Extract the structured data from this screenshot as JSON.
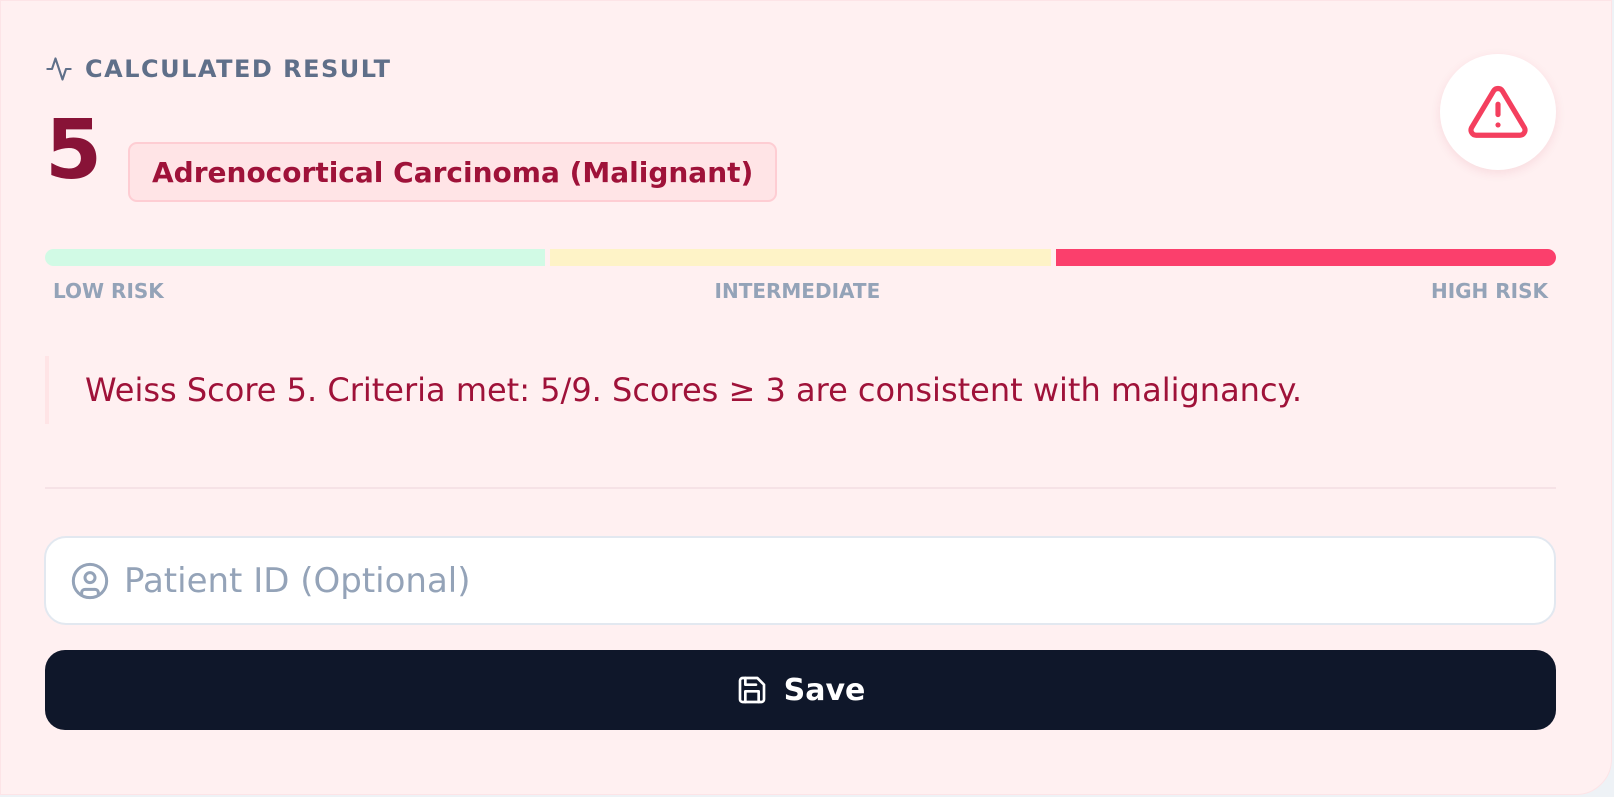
{
  "result": {
    "section_label": "CALCULATED RESULT",
    "score": "5",
    "classification": "Adrenocortical Carcinoma (Malignant)",
    "level": "high"
  },
  "risk_scale": {
    "labels": [
      "LOW RISK",
      "INTERMEDIATE",
      "HIGH RISK"
    ],
    "active_segment": "high"
  },
  "interpretation": "Weiss Score 5. Criteria met: 5/9. Scores ≥ 3 are consistent with malignancy.",
  "patient_input": {
    "placeholder": "Patient ID (Optional)",
    "value": ""
  },
  "save_button": {
    "label": "Save"
  },
  "icons": {
    "label": "activity-icon",
    "status": "alert-triangle-icon",
    "input": "user-circle-icon",
    "save": "floppy-disk-icon"
  },
  "colors": {
    "low": "#d1fae5",
    "intermediate": "#fef3c7",
    "high": "#fb3f6c",
    "accent_text": "#9f1239",
    "score": "#881337",
    "button": "#0f172a"
  }
}
